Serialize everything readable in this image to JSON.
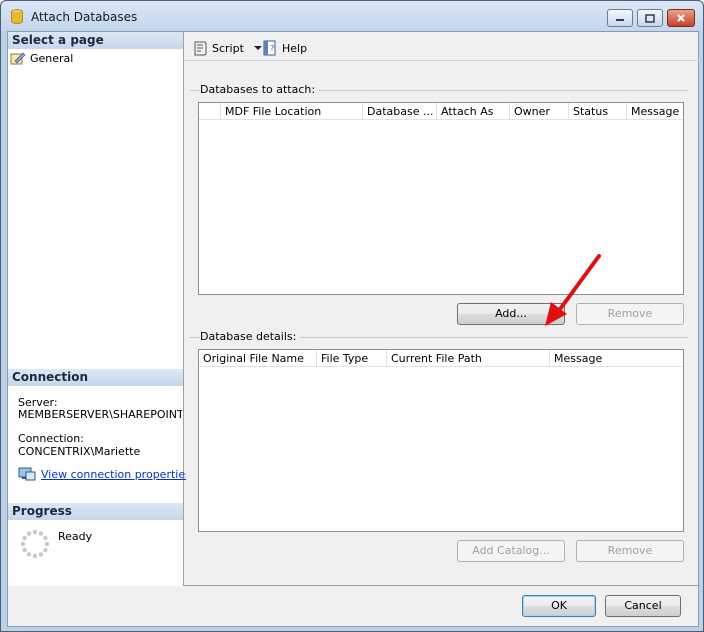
{
  "window": {
    "title": "Attach Databases",
    "controls": {
      "minimize": "minimize",
      "maximize": "maximize",
      "close": "close"
    }
  },
  "left_pane": {
    "select_page_header": "Select a page",
    "pages": [
      {
        "label": "General",
        "icon": "general-page-icon"
      }
    ],
    "connection": {
      "header": "Connection",
      "server_label": "Server:",
      "server_value": "MEMBERSERVER\\SHAREPOINT",
      "connection_label": "Connection:",
      "connection_value": "CONCENTRIX\\Mariette",
      "view_properties_link": "View connection properties"
    },
    "progress": {
      "header": "Progress",
      "status": "Ready"
    }
  },
  "toolbar": {
    "script_label": "Script",
    "help_label": "Help"
  },
  "attach": {
    "group_label": "Databases to attach:",
    "columns": [
      "MDF File Location",
      "Database ...",
      "Attach As",
      "Owner",
      "Status",
      "Message"
    ],
    "rows": [],
    "add_button": "Add...",
    "remove_button": "Remove"
  },
  "details": {
    "group_label": "Database details:",
    "columns": [
      "Original File Name",
      "File Type",
      "Current File Path",
      "Message"
    ],
    "rows": [],
    "add_catalog_button": "Add Catalog...",
    "remove_button": "Remove"
  },
  "footer": {
    "ok_button": "OK",
    "cancel_button": "Cancel"
  },
  "colors": {
    "annotation_arrow": "#e01010",
    "link": "#0033cc"
  }
}
